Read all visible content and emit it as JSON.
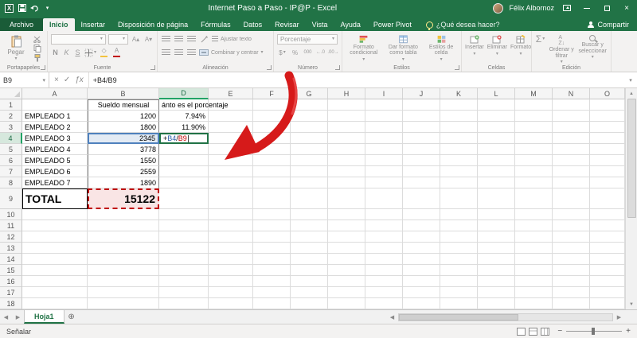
{
  "title_bar": {
    "title": "Internet Paso a Paso - IP@P  -  Excel",
    "user": "Félix Albornoz"
  },
  "ribbon_tabs": [
    {
      "label": "Archivo",
      "file": true
    },
    {
      "label": "Inicio",
      "active": true
    },
    {
      "label": "Insertar"
    },
    {
      "label": "Disposición de página"
    },
    {
      "label": "Fórmulas"
    },
    {
      "label": "Datos"
    },
    {
      "label": "Revisar"
    },
    {
      "label": "Vista"
    },
    {
      "label": "Ayuda"
    },
    {
      "label": "Power Pivot"
    }
  ],
  "assistant_hint": "¿Qué desea hacer?",
  "share_label": "Compartir",
  "ribbon": {
    "groups": [
      "Portapapeles",
      "Fuente",
      "Alineación",
      "Número",
      "Estilos",
      "Celdas",
      "Edición"
    ],
    "paste_label": "Pegar",
    "bold": "N",
    "italic": "K",
    "underline": "S",
    "wrap_label": "Ajustar texto",
    "merge_label": "Combinar y centrar",
    "number_format": "Porcentaje",
    "styles_buttons": [
      "Formato condicional",
      "Dar formato como tabla",
      "Estilos de celda"
    ],
    "cells_buttons": [
      "Insertar",
      "Eliminar",
      "Formato"
    ],
    "edit_buttons": [
      "Ordenar y filtrar",
      "Buscar y seleccionar"
    ]
  },
  "formula_bar": {
    "name_box": "B9",
    "formula": "+B4/B9"
  },
  "grid": {
    "columns": [
      "A",
      "B",
      "D",
      "E",
      "F",
      "G",
      "H",
      "I",
      "J",
      "K",
      "L",
      "M",
      "N",
      "O"
    ],
    "row_count": 18,
    "highlight_col": "D",
    "highlight_row": 4,
    "cells": [
      {
        "col": "B",
        "row": 1,
        "text": "Sueldo mensual",
        "align": "center",
        "cls": "bcol btop"
      },
      {
        "col": "D",
        "row": 1,
        "text": "ánto es el porcentaje"
      },
      {
        "col": "A",
        "row": 2,
        "text": "EMPLEADO 1"
      },
      {
        "col": "B",
        "row": 2,
        "text": "1200",
        "align": "right",
        "cls": "bcol"
      },
      {
        "col": "D",
        "row": 2,
        "text": "7.94%",
        "align": "right"
      },
      {
        "col": "A",
        "row": 3,
        "text": "EMPLEADO 2"
      },
      {
        "col": "B",
        "row": 3,
        "text": "1800",
        "align": "right",
        "cls": "bcol"
      },
      {
        "col": "D",
        "row": 3,
        "text": "11.90%",
        "align": "right"
      },
      {
        "col": "A",
        "row": 4,
        "text": "EMPLEADO 3"
      },
      {
        "col": "B",
        "row": 4,
        "text": "2345",
        "align": "right",
        "cls": "bcol ref-blue"
      },
      {
        "col": "D",
        "row": 4,
        "cls": "editing",
        "parts": [
          {
            "t": "+",
            "c": "#000000"
          },
          {
            "t": "B4",
            "c": "#2a5caa"
          },
          {
            "t": "/",
            "c": "#000000"
          },
          {
            "t": "B9",
            "c": "#c00000"
          }
        ]
      },
      {
        "col": "A",
        "row": 5,
        "text": "EMPLEADO 4"
      },
      {
        "col": "B",
        "row": 5,
        "text": "3778",
        "align": "right",
        "cls": "bcol"
      },
      {
        "col": "A",
        "row": 6,
        "text": "EMPLEADO 5"
      },
      {
        "col": "B",
        "row": 6,
        "text": "1550",
        "align": "right",
        "cls": "bcol"
      },
      {
        "col": "A",
        "row": 7,
        "text": "EMPLEADO 6"
      },
      {
        "col": "B",
        "row": 7,
        "text": "2559",
        "align": "right",
        "cls": "bcol"
      },
      {
        "col": "A",
        "row": 8,
        "text": "EMPLEADO 7"
      },
      {
        "col": "B",
        "row": 8,
        "text": "1890",
        "align": "right",
        "cls": "bcol"
      },
      {
        "col": "A",
        "row": 9,
        "text": "TOTAL",
        "cls": "total-label"
      },
      {
        "col": "B",
        "row": 9,
        "text": "15122",
        "align": "right",
        "cls": "total-value ref-red"
      }
    ]
  },
  "sheet": {
    "tab": "Hoja1"
  },
  "status": {
    "mode": "Señalar"
  },
  "colors": {
    "excel_green": "#217346",
    "reference_blue": "#4f81bd",
    "reference_red": "#c00000",
    "annotation_arrow": "#d61a1a"
  }
}
